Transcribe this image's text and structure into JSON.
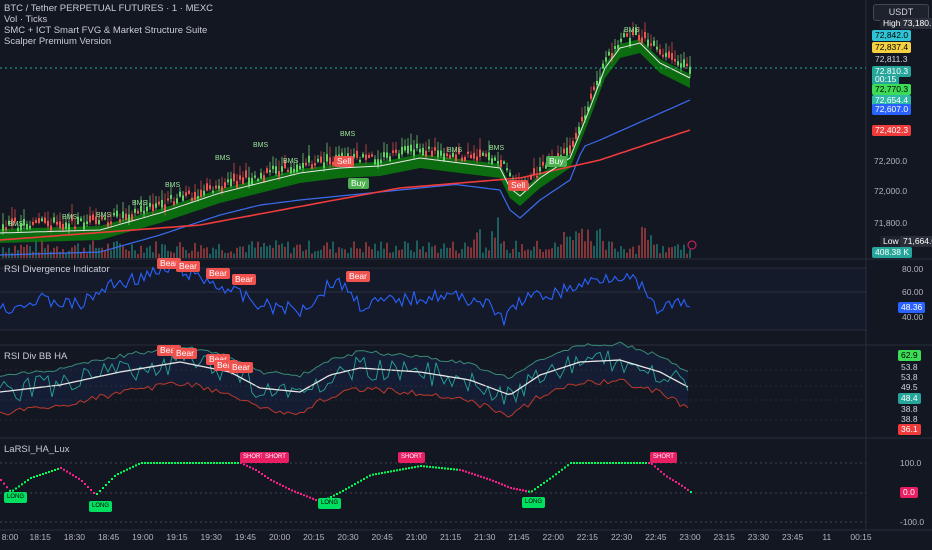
{
  "header": {
    "symbol_line": "BTC / Tether PERPETUAL FUTURES · 1 · MEXC",
    "indicators": [
      "Vol · Ticks",
      "SMC + ICT Smart FVG & Market Structure Suite",
      "Scalper Premium Version"
    ],
    "currency_button": "USDT"
  },
  "main_pane": {
    "high_label": "High",
    "low_label": "Low",
    "high_value": "73,180.1",
    "low_value": "71,664.0",
    "price_scale": [
      "72,200.0",
      "72,000.0",
      "71,800.0"
    ],
    "right_tags": [
      {
        "text": "72,842.0",
        "bg": "#2ec4d6",
        "fg": "#000000"
      },
      {
        "text": "72,837.4",
        "bg": "#f5d041",
        "fg": "#000000"
      },
      {
        "text": "72,811.3",
        "bg": "#131722",
        "fg": "#d1d4dc"
      },
      {
        "text": "72,810.3",
        "bg": "#26a69a",
        "fg": "#ffffff"
      },
      {
        "text": "00:15",
        "bg": "#26a69a",
        "fg": "#ffffff"
      },
      {
        "text": "72,770.3",
        "bg": "#3ddc57",
        "fg": "#000000"
      },
      {
        "text": "72,654.4",
        "bg": "#2eb8a8",
        "fg": "#ffffff"
      },
      {
        "text": "72,607.0",
        "bg": "#2962ff",
        "fg": "#ffffff"
      },
      {
        "text": "72,402.3",
        "bg": "#ef3b3b",
        "fg": "#ffffff"
      }
    ],
    "volume_tag": "408.38 K",
    "bms_labels": [
      "BMS",
      "BMS",
      "BMS",
      "BMS",
      "BMS",
      "BMS",
      "BMS",
      "BMS",
      "BMS",
      "BMS",
      "BMS",
      "BMS"
    ],
    "signals": [
      {
        "text": "Sell",
        "kind": "sell"
      },
      {
        "text": "Buy",
        "kind": "buy"
      },
      {
        "text": "Sell",
        "kind": "sell"
      },
      {
        "text": "Buy",
        "kind": "buy"
      }
    ]
  },
  "rsi_pane": {
    "title": "RSI Divergence Indicator",
    "scale": [
      "80.00",
      "60.00",
      "40.00"
    ],
    "current": "48.36",
    "bear_labels": [
      "Bear",
      "Bear",
      "Bear",
      "Bear",
      "Bear"
    ]
  },
  "bb_pane": {
    "title": "RSI Div BB HA",
    "tags": [
      {
        "text": "62.9",
        "bg": "#3ddc57",
        "fg": "#000000"
      },
      {
        "text": "53.8",
        "bg": "#131722",
        "fg": "#d1d4dc"
      },
      {
        "text": "53.8",
        "bg": "#131722",
        "fg": "#d1d4dc"
      },
      {
        "text": "49.5",
        "bg": "#131722",
        "fg": "#d1d4dc"
      },
      {
        "text": "48.4",
        "bg": "#26a69a",
        "fg": "#ffffff"
      },
      {
        "text": "38.8",
        "bg": "#131722",
        "fg": "#d1d4dc"
      },
      {
        "text": "38.8",
        "bg": "#131722",
        "fg": "#d1d4dc"
      },
      {
        "text": "36.1",
        "bg": "#ef3b3b",
        "fg": "#ffffff"
      }
    ],
    "bear_labels": [
      "Bear",
      "Bear",
      "Bear",
      "Bear",
      "Bear"
    ]
  },
  "larsi_pane": {
    "title": "LaRSI_HA_Lux",
    "scale": [
      "100.0",
      "-100.0"
    ],
    "current": "0.0",
    "short_labels": [
      "SHORT",
      "SHORT",
      "SHORT",
      "SHORT"
    ],
    "long_labels": [
      "LONG",
      "LONG",
      "LONG",
      "LONG"
    ]
  },
  "time_axis": [
    "8:00",
    "18:15",
    "18:30",
    "18:45",
    "19:00",
    "19:15",
    "19:30",
    "19:45",
    "20:00",
    "20:15",
    "20:30",
    "20:45",
    "21:00",
    "21:15",
    "21:30",
    "21:45",
    "22:00",
    "22:15",
    "22:30",
    "22:45",
    "23:00",
    "23:15",
    "23:30",
    "23:45",
    "11",
    "00:15"
  ],
  "colors": {
    "background": "#131722",
    "up": "#26a69a",
    "down": "#ef5350",
    "rsi_line": "#2962ff",
    "larsi_up": "#00ff55",
    "larsi_down": "#ff1f8f",
    "fvg_green": "#0fa30f"
  }
}
